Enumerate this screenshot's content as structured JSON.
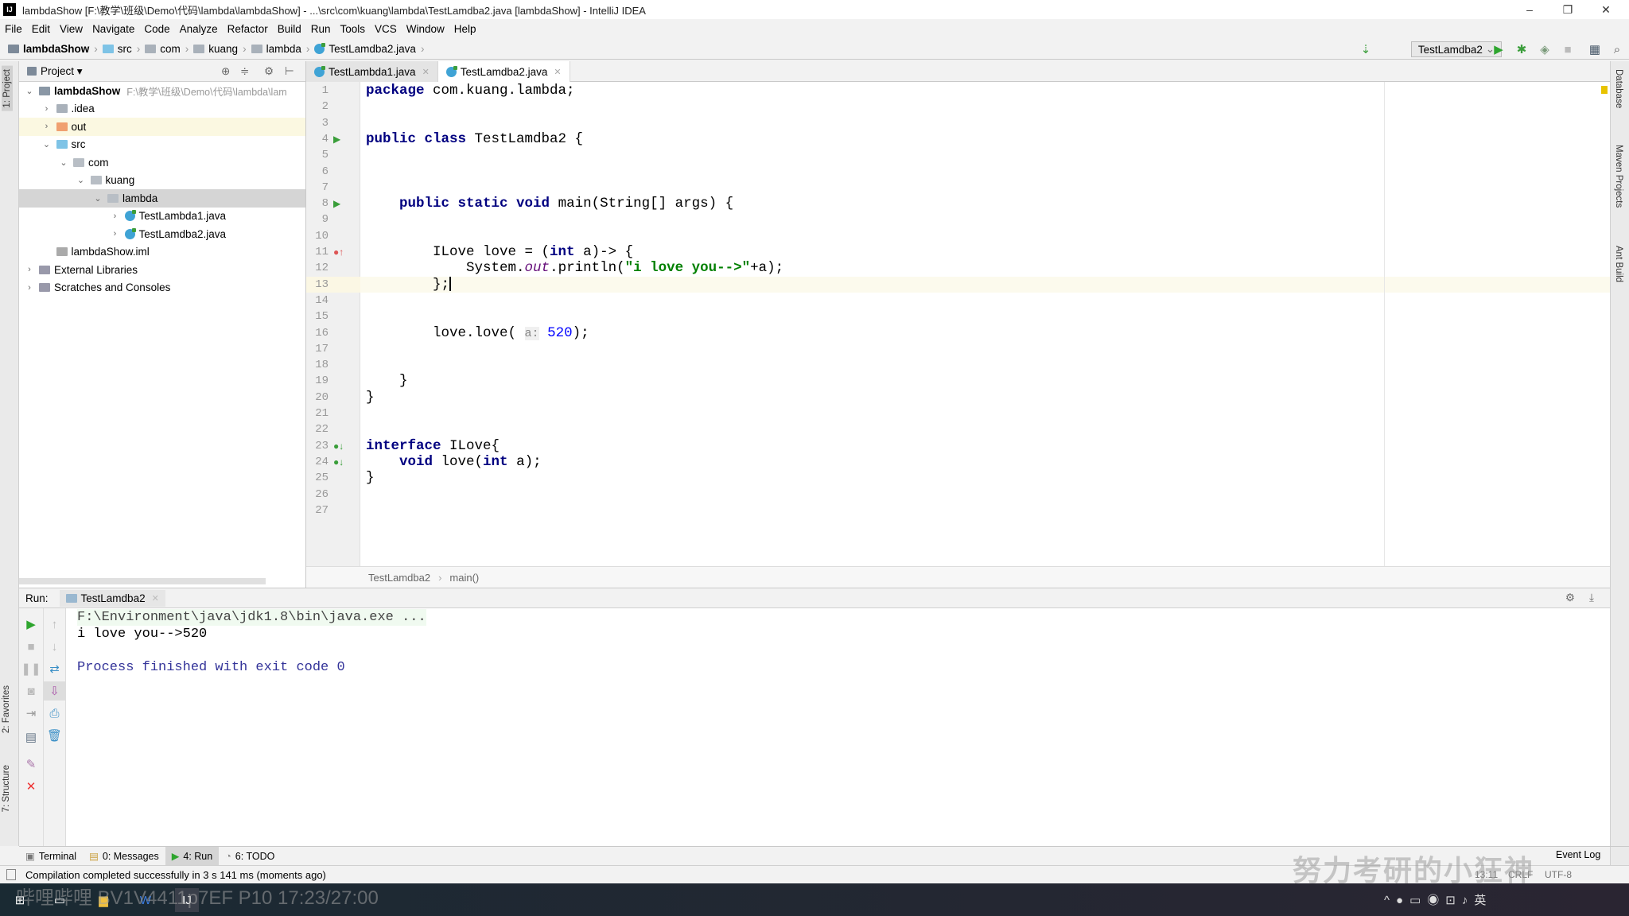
{
  "window": {
    "title": "lambdaShow [F:\\教学\\班级\\Demo\\代码\\lambda\\lambdaShow] - ...\\src\\com\\kuang\\lambda\\TestLamdba2.java [lambdaShow] - IntelliJ IDEA",
    "app_icon": "IJ",
    "minimize": "–",
    "restore": "❐",
    "close": "✕"
  },
  "menu": [
    "File",
    "Edit",
    "View",
    "Navigate",
    "Code",
    "Analyze",
    "Refactor",
    "Build",
    "Run",
    "Tools",
    "VCS",
    "Window",
    "Help"
  ],
  "breadcrumb": [
    "lambdaShow",
    "src",
    "com",
    "kuang",
    "lambda",
    "TestLamdba2.java"
  ],
  "toolbar": {
    "run_config": "TestLamdba2",
    "icons": [
      "sort-icon",
      "run-icon",
      "debug-icon",
      "coverage-icon",
      "stop-icon",
      "project-structure-icon",
      "search-icon"
    ]
  },
  "left_strip": {
    "project": "1: Project",
    "favorites": "2: Favorites",
    "structure": "7: Structure"
  },
  "right_strip": {
    "database": "Database",
    "maven": "Maven Projects",
    "ant": "Ant Build"
  },
  "project_panel": {
    "title": "Project ▾",
    "tree": [
      {
        "label": "lambdaShow",
        "extra": "F:\\教学\\班级\\Demo\\代码\\lambda\\lam",
        "depth": 0,
        "arrow": "v",
        "icon": "module",
        "bold": true
      },
      {
        "label": ".idea",
        "depth": 1,
        "arrow": ">",
        "icon": "folder"
      },
      {
        "label": "out",
        "depth": 1,
        "arrow": ">",
        "icon": "folder-orange",
        "highlight": "out"
      },
      {
        "label": "src",
        "depth": 1,
        "arrow": "v",
        "icon": "folder-blue"
      },
      {
        "label": "com",
        "depth": 2,
        "arrow": "v",
        "icon": "package"
      },
      {
        "label": "kuang",
        "depth": 3,
        "arrow": "v",
        "icon": "package"
      },
      {
        "label": "lambda",
        "depth": 4,
        "arrow": "v",
        "icon": "package",
        "selected": true
      },
      {
        "label": "TestLambda1.java",
        "depth": 5,
        "arrow": ">",
        "icon": "java"
      },
      {
        "label": "TestLamdba2.java",
        "depth": 5,
        "arrow": ">",
        "icon": "java"
      },
      {
        "label": "lambdaShow.iml",
        "depth": 1,
        "arrow": "",
        "icon": "file"
      },
      {
        "label": "External Libraries",
        "depth": 0,
        "arrow": ">",
        "icon": "library"
      },
      {
        "label": "Scratches and Consoles",
        "depth": 0,
        "arrow": ">",
        "icon": "scratch"
      }
    ]
  },
  "editor_tabs": [
    {
      "label": "TestLambda1.java",
      "active": false
    },
    {
      "label": "TestLamdba2.java",
      "active": true
    }
  ],
  "code": {
    "current_line": 13,
    "lines": [
      [
        {
          "t": "package ",
          "c": "kw"
        },
        {
          "t": "com.kuang.lambda;",
          "c": "plain"
        }
      ],
      [],
      [],
      [
        {
          "t": "public class ",
          "c": "kw"
        },
        {
          "t": "TestLamdba2 {",
          "c": "plain"
        }
      ],
      [],
      [],
      [],
      [
        {
          "t": "    "
        },
        {
          "t": "public static void ",
          "c": "kw"
        },
        {
          "t": "main(String[] args) {",
          "c": "plain"
        }
      ],
      [],
      [],
      [
        {
          "t": "        ILove love = ("
        },
        {
          "t": "int ",
          "c": "kw"
        },
        {
          "t": "a)-> {"
        }
      ],
      [
        {
          "t": "            System."
        },
        {
          "t": "out",
          "c": "fld"
        },
        {
          "t": ".println("
        },
        {
          "t": "\"i love you-->\"",
          "c": "str"
        },
        {
          "t": "+a);"
        }
      ],
      [
        {
          "t": "        };"
        }
      ],
      [],
      [],
      [
        {
          "t": "        love.love( "
        },
        {
          "t": "a:",
          "c": "hint"
        },
        {
          "t": " "
        },
        {
          "t": "520",
          "c": "num"
        },
        {
          "t": ");"
        }
      ],
      [],
      [],
      [
        {
          "t": "    }"
        }
      ],
      [
        {
          "t": "}"
        }
      ],
      [],
      [],
      [
        {
          "t": "interface ",
          "c": "kw"
        },
        {
          "t": "ILove{"
        }
      ],
      [
        {
          "t": "    "
        },
        {
          "t": "void ",
          "c": "kw"
        },
        {
          "t": "love("
        },
        {
          "t": "int ",
          "c": "kw"
        },
        {
          "t": "a);"
        }
      ],
      [
        {
          "t": "}"
        }
      ],
      [],
      []
    ],
    "gutter_marks": [
      {
        "line": 4,
        "icon": "run-gutter-icon"
      },
      {
        "line": 8,
        "icon": "run-gutter-icon"
      },
      {
        "line": 11,
        "icon": "lambda-override-icon"
      },
      {
        "line": 23,
        "icon": "implemented-icon"
      },
      {
        "line": 24,
        "icon": "implemented-icon"
      }
    ]
  },
  "editor_breadcrumb": [
    "TestLamdba2",
    "main()"
  ],
  "run_panel": {
    "label": "Run:",
    "tab": "TestLamdba2",
    "output": [
      {
        "text": "F:\\Environment\\java\\jdk1.8\\bin\\java.exe ...",
        "kind": "cmd"
      },
      {
        "text": "i love you-->520",
        "kind": "out"
      },
      {
        "text": "",
        "kind": "out"
      },
      {
        "text": "Process finished with exit code 0",
        "kind": "sys"
      }
    ]
  },
  "bottom_tabs": [
    {
      "label": "Terminal"
    },
    {
      "label": "0: Messages"
    },
    {
      "label": "4: Run",
      "active": true
    },
    {
      "label": "6: TODO"
    }
  ],
  "event_log": "Event Log",
  "status": {
    "message": "Compilation completed successfully in 3 s 141 ms (moments ago)",
    "position": "13:11",
    "line_sep": "CRLF",
    "encoding": "UTF-8"
  },
  "overlay": {
    "watermark": "努力考研的小狂神",
    "video_info": "哔哩哔哩 BV1V4411p7EF P10 17:23/27:00"
  },
  "colors": {
    "keyword": "#000080",
    "string": "#008000",
    "number": "#0000ff",
    "field": "#660e7a",
    "current_line": "#fcfaed",
    "selected": "#d5d5d5"
  }
}
